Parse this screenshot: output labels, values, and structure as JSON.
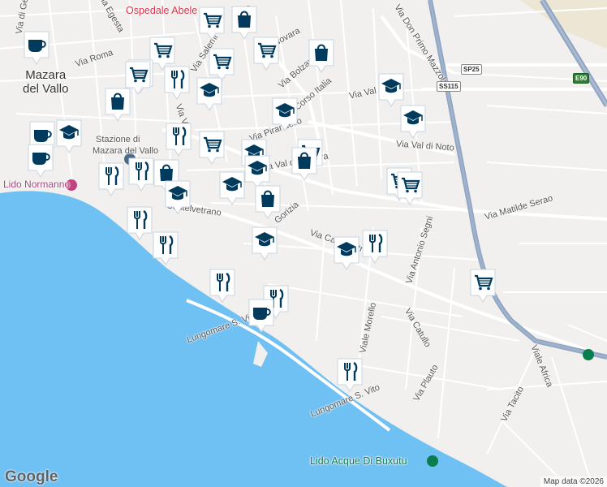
{
  "map": {
    "water_color": "#6fc0f3",
    "land_color": "#f1f0ee",
    "road_color": "#ffffff",
    "highway_color": "#8fa4c2",
    "marker_color": "#003a5c",
    "poi_color": "#d6334a",
    "park_color": "#0a7d4f"
  },
  "labels": {
    "city": [
      "Mazara",
      "del Vallo"
    ],
    "hospital": "Ospedale Abele",
    "stazione": [
      "Stazione di",
      "Mazara del Vallo"
    ],
    "normanno": "Lido Normanno",
    "lido_acque": "Lido Acque Di Buxutu",
    "lungomare1": "Lungomare S. Vito",
    "lungomare2": "Lungomare S. Vito",
    "via_roma": "Via Roma",
    "via_novara": "Via Novara",
    "via_bolzano": "Via Bolzano",
    "corso_italia": "Corso Italia",
    "via_don_primo": "Via Don Primo Mazzolari",
    "via_val_mazara": "Via Val di Mazara",
    "via_val_noto": "Via Val di Noto",
    "via_matilde": "Via Matilde Serao",
    "via_antonio_segni": "Via Antonio Segni",
    "via_castelvetrano1": "Via Castelvetrano",
    "via_castelvetrano2": "Castelvetrano",
    "via_catullo": "Via Catullo",
    "via_plauto": "Via Plauto",
    "via_tacito": "Via Tacito",
    "viale_africa": "Viale Africa",
    "via_morello": "Viale Morello",
    "via_pirandello": "Via Pirandello",
    "via_salemi": "Via Salemi",
    "via_gesu": "Via di Gesù",
    "via_egesta": "Via Egesta",
    "via_gorizia": "Gorizia",
    "via_val_short": "Via Val di",
    "via_vi": "Via Vi",
    "shield_sp25": "SP25",
    "shield_ss115": "SS115",
    "shield_e90": "E90",
    "google": "Google",
    "map_data": "Map data ©2026"
  },
  "markers": [
    {
      "icon": "cafe",
      "name": "marker-cafe"
    },
    {
      "icon": "cart",
      "name": "marker-grocery"
    },
    {
      "icon": "cart",
      "name": "marker-grocery"
    },
    {
      "icon": "cart",
      "name": "marker-grocery"
    },
    {
      "icon": "bag",
      "name": "marker-store"
    },
    {
      "icon": "cart",
      "name": "marker-grocery"
    },
    {
      "icon": "cart",
      "name": "marker-grocery"
    },
    {
      "icon": "bag",
      "name": "marker-store"
    },
    {
      "icon": "cart",
      "name": "marker-grocery"
    },
    {
      "icon": "fork",
      "name": "marker-restaurant"
    },
    {
      "icon": "school",
      "name": "marker-school"
    },
    {
      "icon": "bag",
      "name": "marker-store"
    },
    {
      "icon": "school",
      "name": "marker-school"
    },
    {
      "icon": "school",
      "name": "marker-school"
    },
    {
      "icon": "school",
      "name": "marker-school"
    },
    {
      "icon": "cafe",
      "name": "marker-cafe"
    },
    {
      "icon": "school",
      "name": "marker-school"
    },
    {
      "icon": "fork",
      "name": "marker-restaurant"
    },
    {
      "icon": "cart",
      "name": "marker-grocery"
    },
    {
      "icon": "school",
      "name": "marker-school"
    },
    {
      "icon": "school",
      "name": "marker-school"
    },
    {
      "icon": "cart",
      "name": "marker-grocery"
    },
    {
      "icon": "bag",
      "name": "marker-store"
    },
    {
      "icon": "cafe",
      "name": "marker-cafe"
    },
    {
      "icon": "fork",
      "name": "marker-restaurant"
    },
    {
      "icon": "fork",
      "name": "marker-restaurant"
    },
    {
      "icon": "bag",
      "name": "marker-store"
    },
    {
      "icon": "school",
      "name": "marker-school"
    },
    {
      "icon": "school",
      "name": "marker-school"
    },
    {
      "icon": "cart",
      "name": "marker-grocery"
    },
    {
      "icon": "bag",
      "name": "marker-store"
    },
    {
      "icon": "cart",
      "name": "marker-grocery"
    },
    {
      "icon": "fork",
      "name": "marker-restaurant"
    },
    {
      "icon": "fork",
      "name": "marker-restaurant"
    },
    {
      "icon": "school",
      "name": "marker-school"
    },
    {
      "icon": "school",
      "name": "marker-school"
    },
    {
      "icon": "fork",
      "name": "marker-restaurant"
    },
    {
      "icon": "cart",
      "name": "marker-grocery"
    },
    {
      "icon": "fork",
      "name": "marker-restaurant"
    },
    {
      "icon": "fork",
      "name": "marker-restaurant"
    },
    {
      "icon": "cafe",
      "name": "marker-cafe"
    },
    {
      "icon": "fork",
      "name": "marker-restaurant"
    }
  ]
}
